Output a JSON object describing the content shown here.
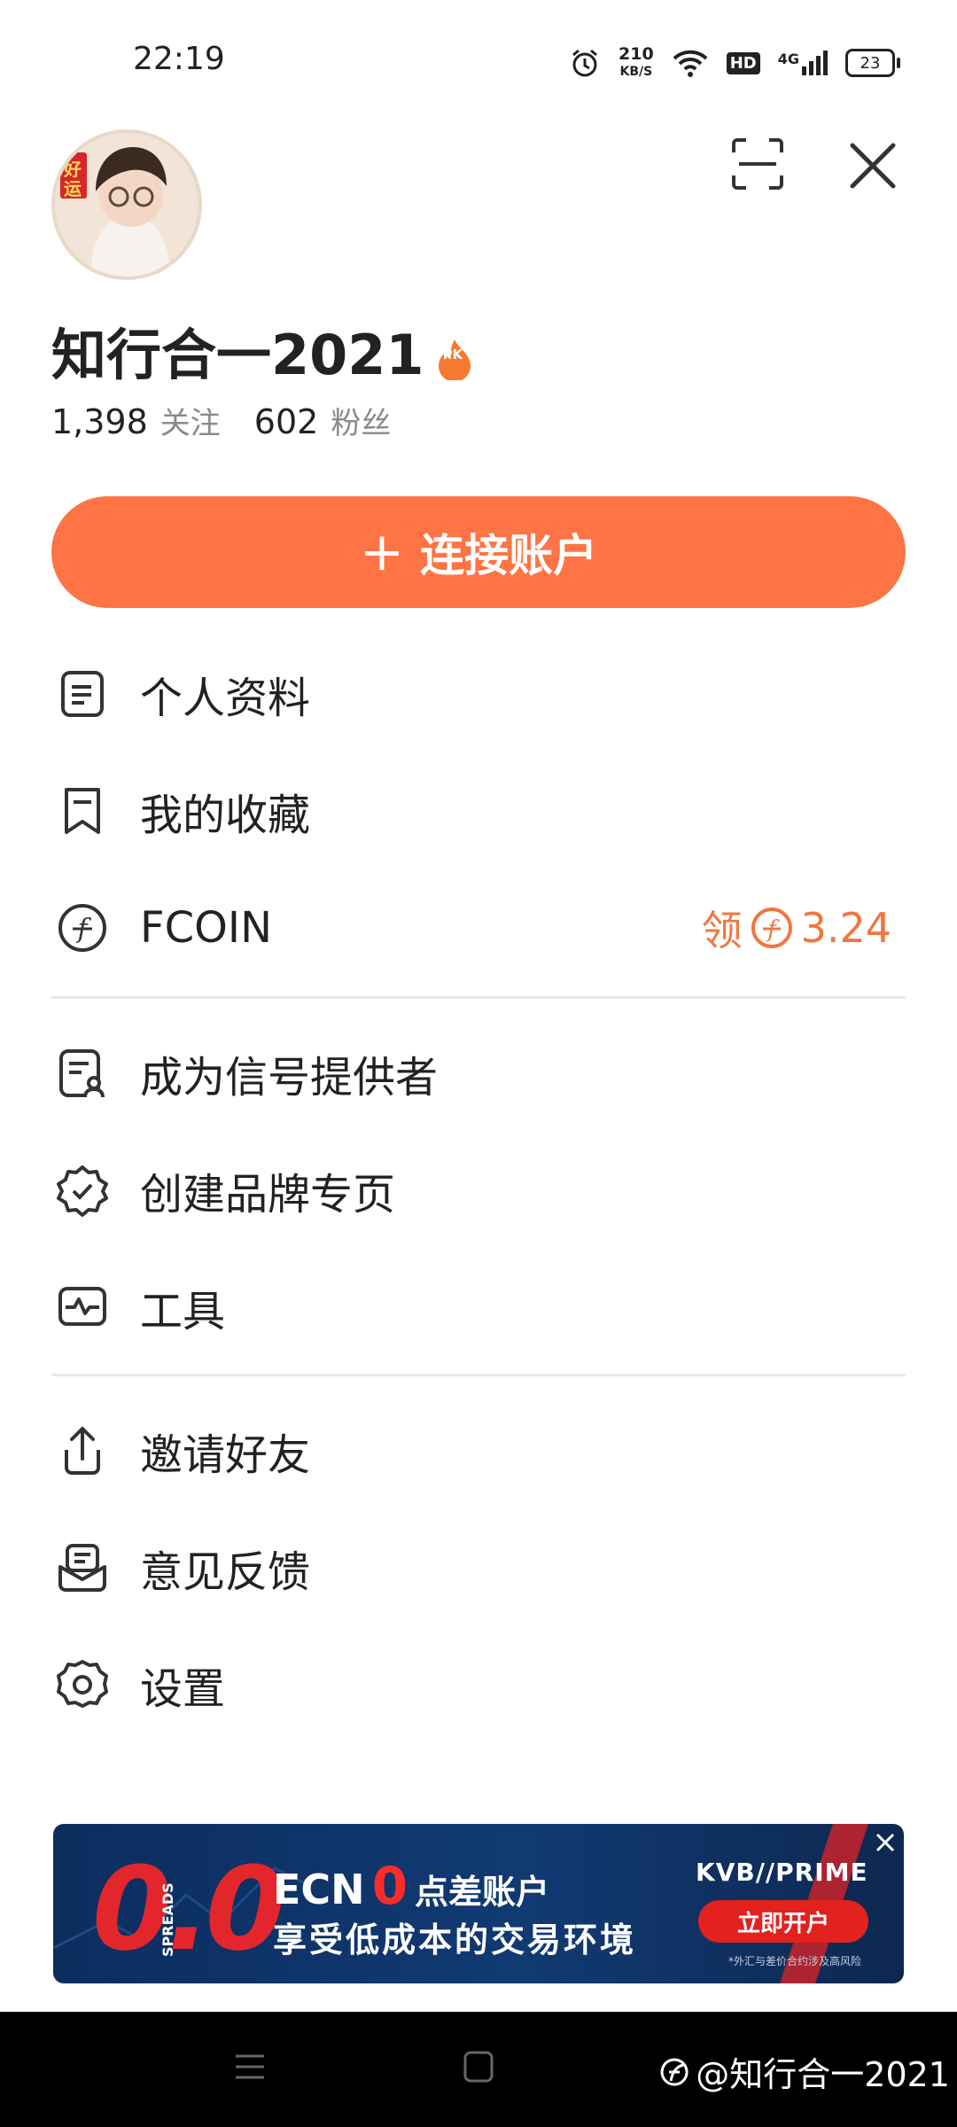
{
  "status_bar": {
    "time": "22:19",
    "speed_value": "210",
    "speed_unit": "KB/S",
    "hd": "HD",
    "network": "4G",
    "battery": "23"
  },
  "profile": {
    "avatar_badge": "好运",
    "name": "知行合一2021",
    "name_badge": "PK",
    "following_count": "1,398",
    "following_label": "关注",
    "followers_count": "602",
    "followers_label": "粉丝"
  },
  "connect_button": {
    "plus": "+",
    "label": "连接账户"
  },
  "menu": {
    "profile_label": "个人资料",
    "favorites_label": "我的收藏",
    "fcoin_label": "FCOIN",
    "fcoin_claim": "领",
    "fcoin_value": "3.24",
    "signal_provider_label": "成为信号提供者",
    "brand_page_label": "创建品牌专页",
    "tools_label": "工具",
    "invite_label": "邀请好友",
    "feedback_label": "意见反馈",
    "settings_label": "设置"
  },
  "banner": {
    "zero": "0.0",
    "spreads": "SPREADS",
    "ecn": "ECN",
    "ecn_zero": "0",
    "ecn_suffix": "点差账户",
    "subtitle": "享受低成本的交易环境",
    "brand": "KVB//PRIME",
    "cta": "立即开户",
    "note": "*外汇与差价合约涉及高风险"
  },
  "watermark": "@知行合一2021",
  "colors": {
    "accent": "#fe7444",
    "fcoin": "#f0773f"
  }
}
